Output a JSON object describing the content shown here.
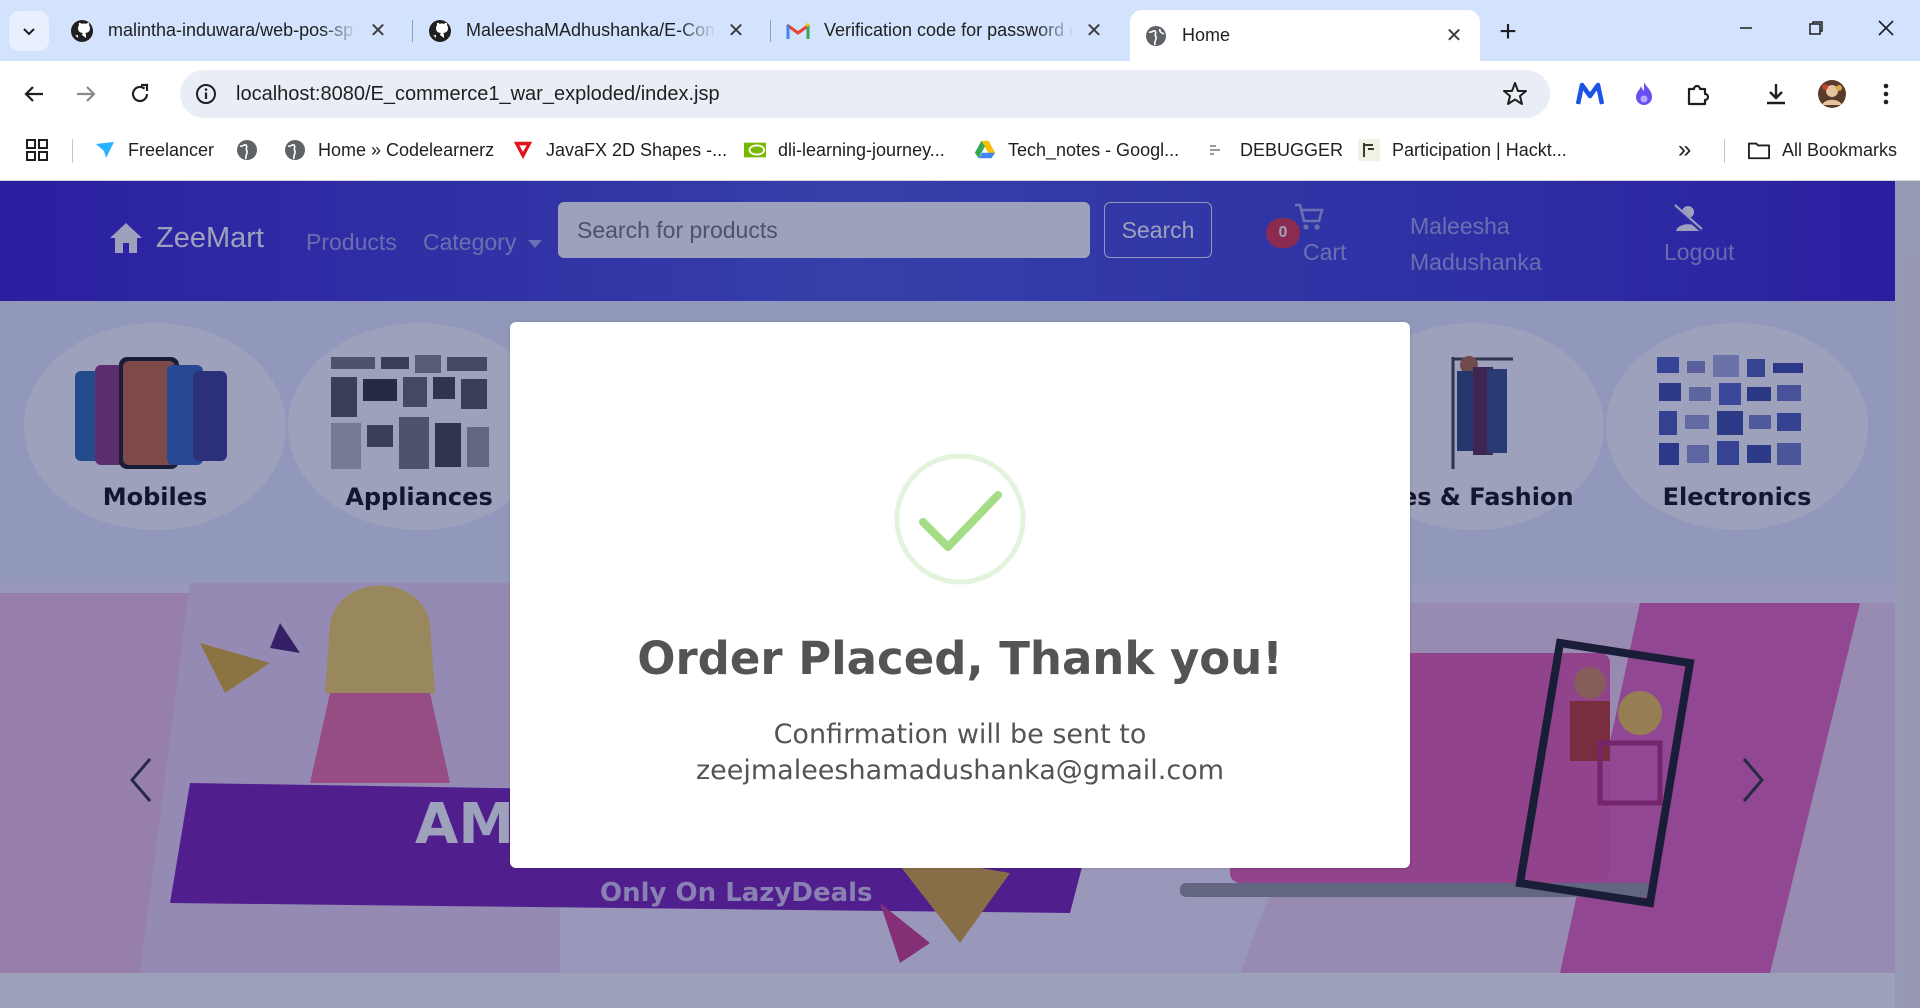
{
  "browser": {
    "tabs": [
      {
        "title": "malintha-induwara/web-pos-sp",
        "icon": "github-icon",
        "active": false
      },
      {
        "title": "MaleeshaMAdhushanka/E-Com",
        "icon": "github-icon",
        "active": false
      },
      {
        "title": "Verification code for password c",
        "icon": "gmail-icon",
        "active": false
      },
      {
        "title": "Home",
        "icon": "globe-icon",
        "active": true
      }
    ],
    "url": "localhost:8080/E_commerce1_war_exploded/index.jsp",
    "bookmarks": [
      {
        "label": "Freelancer",
        "icon": "freelancer-icon"
      },
      {
        "label": "",
        "icon": "globe-icon"
      },
      {
        "label": "Home » Codelearnerz",
        "icon": "globe-icon"
      },
      {
        "label": "JavaFX 2D Shapes -...",
        "icon": "triangle-icon"
      },
      {
        "label": "dli-learning-journey...",
        "icon": "nvidia-icon"
      },
      {
        "label": "Tech_notes - Googl...",
        "icon": "drive-icon"
      },
      {
        "label": "DEBUGGER",
        "icon": "debugger-icon"
      },
      {
        "label": "Participation | Hackt...",
        "icon": "hackathon-icon"
      }
    ],
    "all_bookmarks": "All Bookmarks",
    "overflow": "»"
  },
  "site": {
    "brand": "ZeeMart",
    "nav": {
      "products": "Products",
      "category": "Category"
    },
    "search": {
      "placeholder": "Search for products",
      "button": "Search"
    },
    "cart": {
      "count": "0",
      "label": "Cart"
    },
    "user": {
      "first": "Maleesha",
      "last": "Madushanka"
    },
    "logout": "Logout",
    "categories": [
      {
        "label": "Mobiles",
        "icon": "mobiles-icon"
      },
      {
        "label": "Appliances",
        "icon": "appliances-icon"
      },
      {
        "label": "thes & Fashion",
        "icon": "clothes-icon"
      },
      {
        "label": "Electronics",
        "icon": "electronics-icon"
      }
    ],
    "banner_text": "AM",
    "banner_sub": "Only On LazyDeals"
  },
  "modal": {
    "title": "Order Placed, Thank you!",
    "line1": "Confirmation will be sent to",
    "line2": "zeejmaleeshamadushanka@gmail.com",
    "icon": "success-check-icon"
  },
  "colors": {
    "navbar": "#3a1fd1",
    "success": "#a5dc86",
    "badge": "#dc3545",
    "tabbar": "#d3e3fd"
  }
}
